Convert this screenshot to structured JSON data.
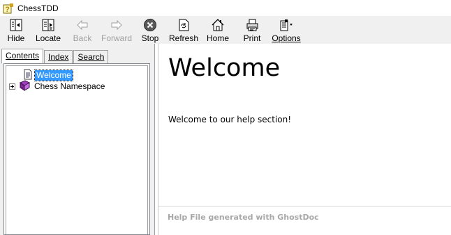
{
  "window": {
    "title": "ChessTDD",
    "icon": "help-question-icon"
  },
  "toolbar": {
    "buttons": [
      {
        "label": "Hide",
        "icon": "hide-pane-icon",
        "enabled": true
      },
      {
        "label": "Locate",
        "icon": "locate-icon",
        "enabled": true
      },
      {
        "label": "Back",
        "icon": "back-arrow-icon",
        "enabled": false
      },
      {
        "label": "Forward",
        "icon": "forward-arrow-icon",
        "enabled": false
      },
      {
        "label": "Stop",
        "icon": "stop-icon",
        "enabled": true
      },
      {
        "label": "Refresh",
        "icon": "refresh-icon",
        "enabled": true
      },
      {
        "label": "Home",
        "icon": "home-icon",
        "enabled": true
      },
      {
        "label": "Print",
        "icon": "print-icon",
        "enabled": true
      },
      {
        "label": "Options",
        "icon": "options-icon",
        "enabled": true
      }
    ]
  },
  "nav": {
    "tabs": [
      {
        "label": "Contents",
        "active": true
      },
      {
        "label": "Index",
        "active": false
      },
      {
        "label": "Search",
        "active": false
      }
    ],
    "tree": [
      {
        "label": "Welcome",
        "icon": "page-icon",
        "selected": true
      },
      {
        "label": "Chess Namespace",
        "icon": "book-icon",
        "selected": false,
        "expandable": true
      }
    ]
  },
  "content": {
    "heading": "Welcome",
    "body": "Welcome to our help section!",
    "footer": "Help File generated with GhostDoc"
  },
  "colors": {
    "selection": "#3399ff",
    "toolbar_bg": "#f0f0f0",
    "footer_text": "#a8a8a8"
  }
}
